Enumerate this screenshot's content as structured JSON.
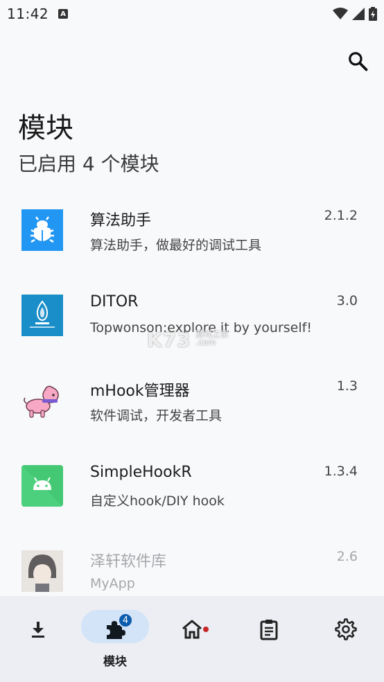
{
  "status_bar": {
    "time": "11:42",
    "indicator": "A",
    "icons": [
      "wifi-icon",
      "signal-icon",
      "battery-charging-icon"
    ]
  },
  "header": {
    "title": "模块",
    "subtitle": "已启用 4 个模块"
  },
  "modules": [
    {
      "name": "算法助手",
      "description": "算法助手，做最好的调试工具",
      "version": "2.1.2",
      "icon": "bug-icon",
      "enabled": true
    },
    {
      "name": "DITOR",
      "description": "Topwonson:explore it by yourself!",
      "version": "3.0",
      "icon": "ditor-logo-icon",
      "enabled": true
    },
    {
      "name": "mHook管理器",
      "description": "软件调试，开发者工具",
      "version": "1.3",
      "icon": "pink-dog-icon",
      "enabled": true
    },
    {
      "name": "SimpleHookR",
      "description": "自定义hook/DIY hook",
      "version": "1.3.4",
      "icon": "android-icon",
      "enabled": true
    },
    {
      "name": "泽轩软件库",
      "description": "MyApp",
      "version": "2.6",
      "icon": "avatar-photo-icon",
      "enabled": false
    }
  ],
  "watermark": {
    "main": "K73",
    "sub": "游戏之家\n.com"
  },
  "bottom_nav": {
    "items": [
      {
        "label": "",
        "icon": "download-icon"
      },
      {
        "label": "模块",
        "icon": "puzzle-icon",
        "badge": "4",
        "active": true
      },
      {
        "label": "",
        "icon": "home-icon",
        "dot": true
      },
      {
        "label": "",
        "icon": "clipboard-icon"
      },
      {
        "label": "",
        "icon": "gear-icon"
      }
    ]
  },
  "colors": {
    "background": "#f8f9fb",
    "nav_background": "#eceef3",
    "active_pill": "#d3e3f8",
    "badge": "#0b5cad",
    "dot": "#c62828",
    "bug_icon_bg": "#2196f3",
    "ditor_bg": "#1a8ec9",
    "android_bg": "#4cd07d"
  }
}
